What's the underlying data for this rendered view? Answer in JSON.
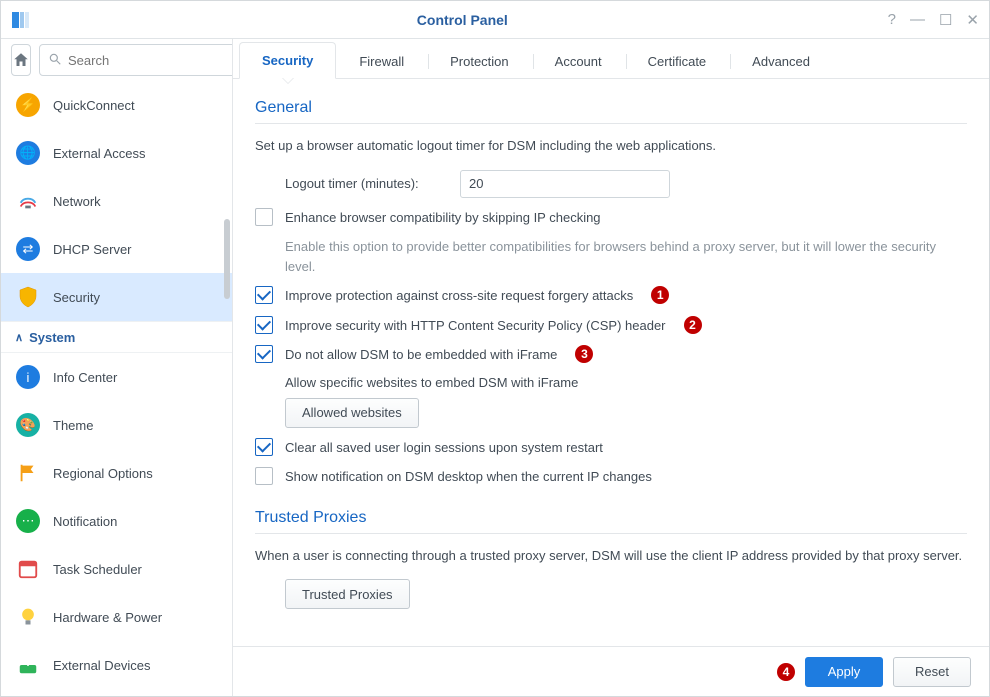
{
  "window": {
    "title": "Control Panel"
  },
  "search": {
    "placeholder": "Search"
  },
  "sidebar": {
    "items": [
      {
        "label": "QuickConnect"
      },
      {
        "label": "External Access"
      },
      {
        "label": "Network"
      },
      {
        "label": "DHCP Server"
      },
      {
        "label": "Security"
      }
    ],
    "group": "System",
    "system_items": [
      {
        "label": "Info Center"
      },
      {
        "label": "Theme"
      },
      {
        "label": "Regional Options"
      },
      {
        "label": "Notification"
      },
      {
        "label": "Task Scheduler"
      },
      {
        "label": "Hardware & Power"
      },
      {
        "label": "External Devices"
      }
    ]
  },
  "tabs": [
    "Security",
    "Firewall",
    "Protection",
    "Account",
    "Certificate",
    "Advanced"
  ],
  "general": {
    "title": "General",
    "desc": "Set up a browser automatic logout timer for DSM including the web applications.",
    "logout_label": "Logout timer (minutes):",
    "logout_value": "20",
    "enhance_label": "Enhance browser compatibility by skipping IP checking",
    "enhance_hint": "Enable this option to provide better compatibilities for browsers behind a proxy server, but it will lower the security level.",
    "csrf_label": "Improve protection against cross-site request forgery attacks",
    "csp_label": "Improve security with HTTP Content Security Policy (CSP) header",
    "iframe_label": "Do not allow DSM to be embedded with iFrame",
    "iframe_sub": "Allow specific websites to embed DSM with iFrame",
    "allowed_btn": "Allowed websites",
    "clear_sessions": "Clear all saved user login sessions upon system restart",
    "ip_notify": "Show notification on DSM desktop when the current IP changes"
  },
  "proxies": {
    "title": "Trusted Proxies",
    "desc": "When a user is connecting through a trusted proxy server, DSM will use the client IP address provided by that proxy server.",
    "btn": "Trusted Proxies"
  },
  "badges": {
    "b1": "1",
    "b2": "2",
    "b3": "3",
    "b4": "4"
  },
  "footer": {
    "apply": "Apply",
    "reset": "Reset"
  }
}
